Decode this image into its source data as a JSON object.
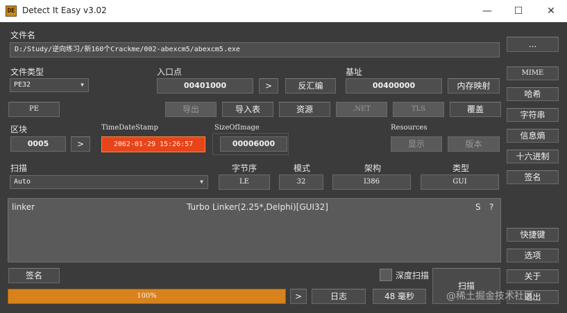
{
  "window": {
    "title": "Detect It Easy v3.02",
    "icon_text": "DE",
    "minimize": "—",
    "maximize": "☐",
    "close": "✕"
  },
  "file": {
    "label": "文件名",
    "path": "D:/Study/逆向练习/新160个Crackme/002-abexcm5/abexcm5.exe",
    "browse": "..."
  },
  "file_type": {
    "label": "文件类型",
    "value": "PE32"
  },
  "entry_point": {
    "label": "入口点",
    "value": "00401000",
    "go": ">",
    "disasm": "反汇编"
  },
  "base": {
    "label": "基址",
    "value": "00400000",
    "memmap": "内存映射"
  },
  "pe_buttons": {
    "pe": "PE",
    "export": "导出",
    "import": "导入表",
    "resources": "资源",
    "net": ".NET",
    "tls": "TLS",
    "overlay": "覆盖"
  },
  "sections": {
    "label": "区块",
    "value": "0005",
    "go": ">"
  },
  "timestamp": {
    "label": "TimeDateStamp",
    "value": "2062-01-29 15:26:57"
  },
  "size_of_image": {
    "label": "SizeOfImage",
    "value": "00006000"
  },
  "resources_group": {
    "label": "Resources",
    "show": "显示",
    "version": "版本"
  },
  "scan": {
    "label": "扫描",
    "mode": "Auto"
  },
  "endian": {
    "label": "字节序",
    "value": "LE"
  },
  "mode": {
    "label": "模式",
    "value": "32"
  },
  "arch": {
    "label": "架构",
    "value": "I386"
  },
  "type": {
    "label": "类型",
    "value": "GUI"
  },
  "result": {
    "kind": "linker",
    "name": "Turbo Linker(2.25*,Delphi)[GUI32]",
    "s": "S",
    "q": "?"
  },
  "right_buttons": {
    "mime": "MIME",
    "hash": "哈希",
    "strings": "字符串",
    "entropy": "信息熵",
    "hex": "十六进制",
    "signatures": "签名",
    "shortcuts": "快捷键",
    "options": "选项",
    "about": "关于",
    "exit": "退出"
  },
  "bottom": {
    "signatures": "签名",
    "deep_scan": "深度扫描",
    "scan": "扫描",
    "progress": "100%",
    "progress_value": 100,
    "go": ">",
    "log": "日志",
    "time": "48 毫秒"
  },
  "watermark": "@稀土掘金技术社区"
}
